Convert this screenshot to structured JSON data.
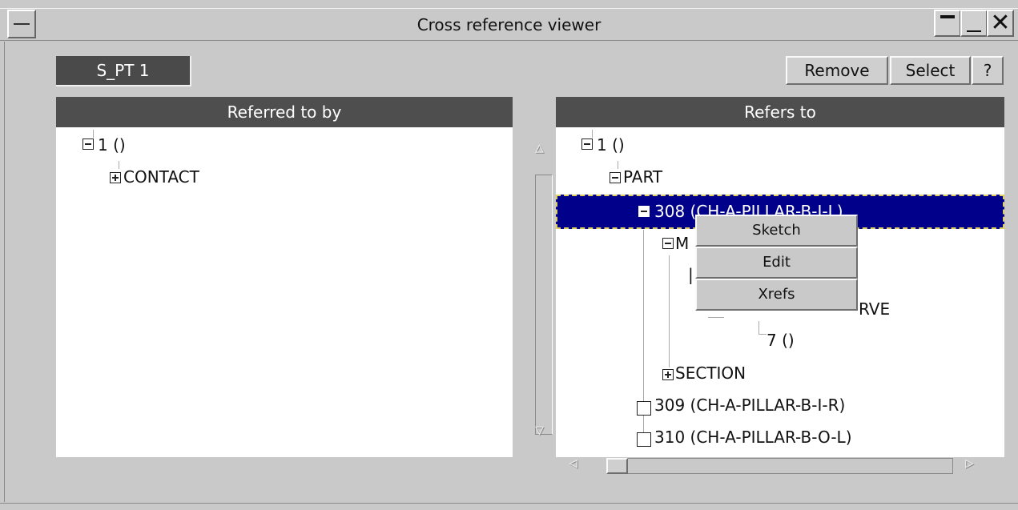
{
  "window": {
    "title": "Cross reference viewer"
  },
  "toolbar": {
    "entity_label": "S_PT 1",
    "remove_label": "Remove",
    "select_label": "Select",
    "help_label": "?"
  },
  "left_panel": {
    "header": "Referred to by",
    "nodes": [
      {
        "label": "1 ()"
      },
      {
        "label": "CONTACT"
      }
    ]
  },
  "right_panel": {
    "header": "Refers to",
    "nodes": [
      {
        "label": "1 ()"
      },
      {
        "label": "PART"
      },
      {
        "label": "308 (CH-A-PILLAR-B-I-L)",
        "selected": true
      },
      {
        "label": "M"
      },
      {
        "label": "RVE"
      },
      {
        "label": "7 ()"
      },
      {
        "label": "SECTION"
      },
      {
        "label": "309 (CH-A-PILLAR-B-I-R)"
      },
      {
        "label": "310 (CH-A-PILLAR-B-O-L)"
      }
    ]
  },
  "context_menu": {
    "items": [
      {
        "label": "Sketch"
      },
      {
        "label": "Edit"
      },
      {
        "label": "Xrefs"
      }
    ]
  },
  "colors": {
    "selection": "#00008a",
    "panel_header": "#4e4e4e",
    "background": "#c9c9c9"
  },
  "icons": {
    "scroll_up": "▵",
    "scroll_down": "▿",
    "scroll_left": "◃",
    "scroll_right": "▹"
  }
}
